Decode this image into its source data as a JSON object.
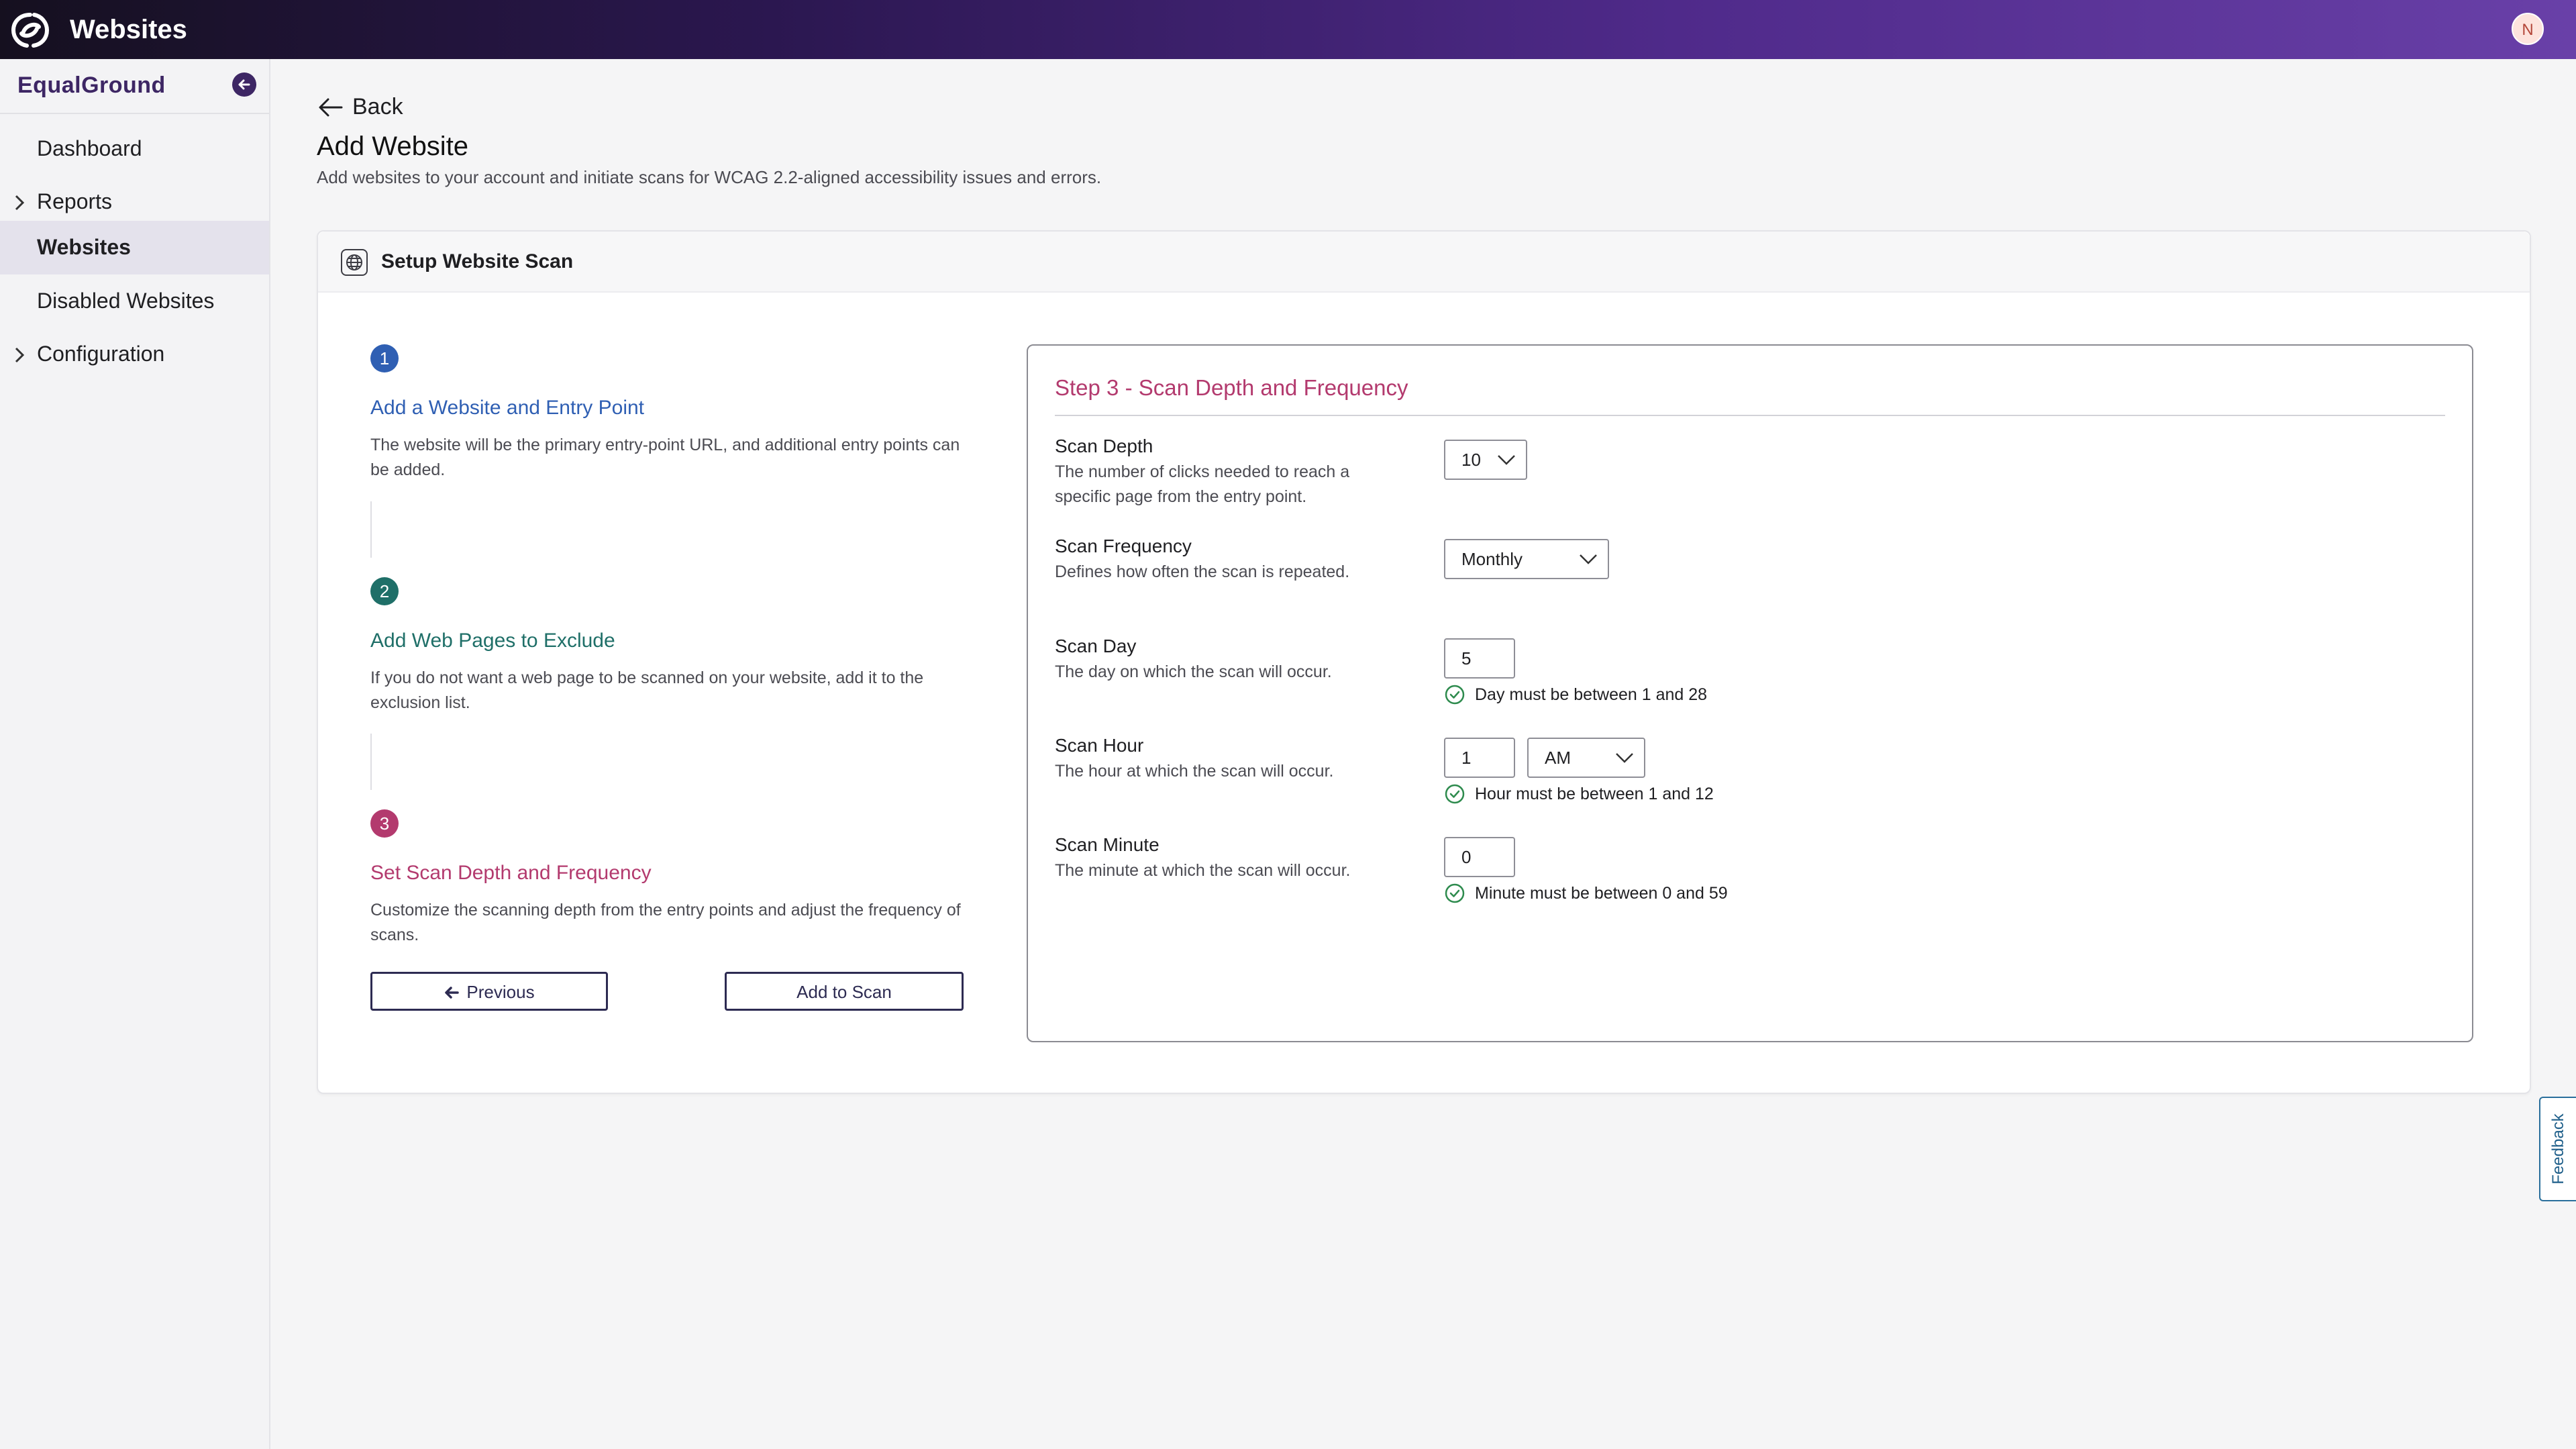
{
  "header": {
    "app_title": "Websites",
    "avatar_initial": "N"
  },
  "sidebar": {
    "org_name": "EqualGround",
    "items": [
      {
        "label": "Dashboard",
        "expandable": false,
        "active": false
      },
      {
        "label": "Reports",
        "expandable": true,
        "active": false
      },
      {
        "label": "Websites",
        "expandable": false,
        "active": true
      },
      {
        "label": "Disabled Websites",
        "expandable": false,
        "active": false
      },
      {
        "label": "Configuration",
        "expandable": true,
        "active": false
      }
    ]
  },
  "main": {
    "back_label": "Back",
    "title": "Add Website",
    "description": "Add websites to your account and initiate scans for WCAG 2.2-aligned accessibility issues and errors."
  },
  "card": {
    "title": "Setup Website Scan",
    "steps": [
      {
        "number": "1",
        "title": "Add a Website and Entry Point",
        "description": "The website will be the primary entry-point URL, and additional entry points can be added.",
        "color": "#2f5fb3"
      },
      {
        "number": "2",
        "title": "Add Web Pages to Exclude",
        "description": "If you do not want a web page to be scanned on your website, add it to the exclusion list.",
        "color": "#1f6f68"
      },
      {
        "number": "3",
        "title": "Set Scan Depth and Frequency",
        "description": "Customize the scanning depth from the entry points and adjust the frequency of scans.",
        "color": "#b33a6e"
      }
    ],
    "buttons": {
      "previous": "Previous",
      "add_to_scan": "Add to Scan"
    }
  },
  "step3_panel": {
    "title": "Step 3 - Scan Depth and Frequency",
    "fields": {
      "scan_depth": {
        "label": "Scan Depth",
        "help": "The number of clicks needed to reach a specific page from the entry point.",
        "value": "10"
      },
      "scan_frequency": {
        "label": "Scan Frequency",
        "help": "Defines how often the scan is repeated.",
        "value": "Monthly"
      },
      "scan_day": {
        "label": "Scan Day",
        "help": "The day on which the scan will occur.",
        "value": "5",
        "validation": "Day must be between 1 and 28"
      },
      "scan_hour": {
        "label": "Scan Hour",
        "help": "The hour at which the scan will occur.",
        "value": "1",
        "period": "AM",
        "validation": "Hour must be between 1 and 12"
      },
      "scan_minute": {
        "label": "Scan Minute",
        "help": "The minute at which the scan will occur.",
        "value": "0",
        "validation": "Minute must be between 0 and 59"
      }
    }
  },
  "feedback_label": "Feedback",
  "colors": {
    "brand_dark": "#3d2664",
    "step1": "#2f5fb3",
    "step2": "#1f6f68",
    "step3": "#b33a6e",
    "valid_green": "#2e8b4e",
    "button_border": "#2d2b52"
  }
}
